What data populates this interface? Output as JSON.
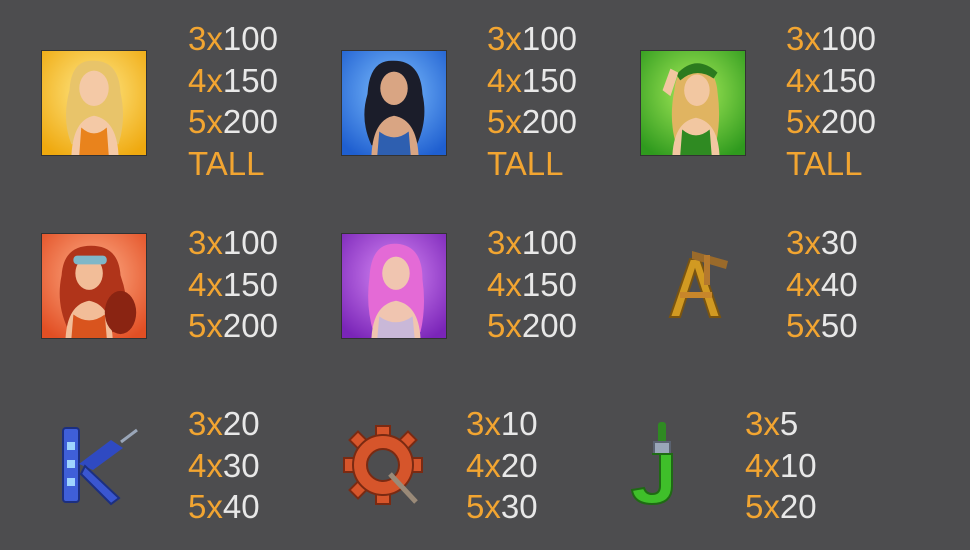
{
  "symbols": [
    {
      "icon": "blonde-girl-orange-icon",
      "bg": "#f2c11b",
      "pays": [
        {
          "mult": "3x",
          "amt": "100"
        },
        {
          "mult": "4x",
          "amt": "150"
        },
        {
          "mult": "5x",
          "amt": "200"
        }
      ],
      "tall": "TALL"
    },
    {
      "icon": "brunette-girl-blue-icon",
      "bg": "#2f79e2",
      "pays": [
        {
          "mult": "3x",
          "amt": "100"
        },
        {
          "mult": "4x",
          "amt": "150"
        },
        {
          "mult": "5x",
          "amt": "200"
        }
      ],
      "tall": "TALL"
    },
    {
      "icon": "green-hat-girl-icon",
      "bg": "#48b52a",
      "pays": [
        {
          "mult": "3x",
          "amt": "100"
        },
        {
          "mult": "4x",
          "amt": "150"
        },
        {
          "mult": "5x",
          "amt": "200"
        }
      ],
      "tall": "TALL"
    },
    {
      "icon": "redhead-girl-goggles-icon",
      "bg": "#ec6c3b",
      "pays": [
        {
          "mult": "3x",
          "amt": "100"
        },
        {
          "mult": "4x",
          "amt": "150"
        },
        {
          "mult": "5x",
          "amt": "200"
        }
      ]
    },
    {
      "icon": "pink-hair-girl-icon",
      "bg": "#9d3cd6",
      "pays": [
        {
          "mult": "3x",
          "amt": "100"
        },
        {
          "mult": "4x",
          "amt": "150"
        },
        {
          "mult": "5x",
          "amt": "200"
        }
      ]
    },
    {
      "icon": "letter-a-tools-icon",
      "pays": [
        {
          "mult": "3x",
          "amt": "30"
        },
        {
          "mult": "4x",
          "amt": "40"
        },
        {
          "mult": "5x",
          "amt": "50"
        }
      ]
    },
    {
      "icon": "letter-k-drill-icon",
      "pays": [
        {
          "mult": "3x",
          "amt": "20"
        },
        {
          "mult": "4x",
          "amt": "30"
        },
        {
          "mult": "5x",
          "amt": "40"
        }
      ]
    },
    {
      "icon": "letter-q-gear-icon",
      "pays": [
        {
          "mult": "3x",
          "amt": "10"
        },
        {
          "mult": "4x",
          "amt": "20"
        },
        {
          "mult": "5x",
          "amt": "30"
        }
      ]
    },
    {
      "icon": "letter-j-paintbrush-icon",
      "pays": [
        {
          "mult": "3x",
          "amt": "5"
        },
        {
          "mult": "4x",
          "amt": "10"
        },
        {
          "mult": "5x",
          "amt": "20"
        }
      ]
    }
  ]
}
